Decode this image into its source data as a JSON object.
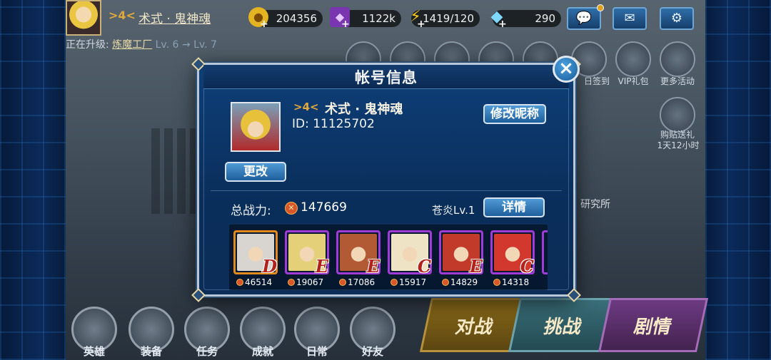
{
  "topbar": {
    "player_name": "术式 · 鬼神魂",
    "rank": "4",
    "gold": "204356",
    "crystal": "1122k",
    "stamina": "1419/120",
    "gems": "290"
  },
  "upgrade": {
    "prefix": "正在升级:",
    "building": "炼魔工厂",
    "from_level": "Lv. 6",
    "to_level": "Lv. 7",
    "arrow": "→"
  },
  "right_menu": {
    "sign_in": "日签到",
    "vip_gift": "VIP礼包",
    "more_events": "更多活动",
    "share_gift": "购贴送礼",
    "share_time": "1天12小时",
    "institute": "研究所"
  },
  "bottom_nav": {
    "heroes": "英雄",
    "equipment": "装备",
    "tasks": "任务",
    "achievements": "成就",
    "daily": "日常",
    "friends": "好友",
    "battle": "对战",
    "challenge": "挑战",
    "story": "剧情"
  },
  "modal": {
    "title": "帐号信息",
    "close": "×",
    "rank": "4",
    "name": "术式 · 鬼神魂",
    "id_label": "ID: 11125702",
    "rename_button": "修改昵称",
    "change_button": "更改",
    "total_power_label": "总战力:",
    "total_power_value": "147669",
    "team_name": "苍炎Lv.1",
    "details_button": "详情",
    "heroes": [
      {
        "grade": "D",
        "power": "46514",
        "border": "#e28a1c",
        "face": "#d8d4d0"
      },
      {
        "grade": "E",
        "power": "19067",
        "border": "#a13bd6",
        "face": "#e5d07a"
      },
      {
        "grade": "E",
        "power": "17086",
        "border": "#a13bd6",
        "face": "#b25a34"
      },
      {
        "grade": "C",
        "power": "15917",
        "border": "#a13bd6",
        "face": "#efe3c6"
      },
      {
        "grade": "E",
        "power": "14829",
        "border": "#a13bd6",
        "face": "#c23a2a"
      },
      {
        "grade": "C",
        "power": "14318",
        "border": "#a13bd6",
        "face": "#d2382e"
      }
    ]
  },
  "colors": {
    "modal_bg": "#0e3f78",
    "button_blue": "#4f9ad6",
    "accent_gold": "#e0a83d"
  }
}
